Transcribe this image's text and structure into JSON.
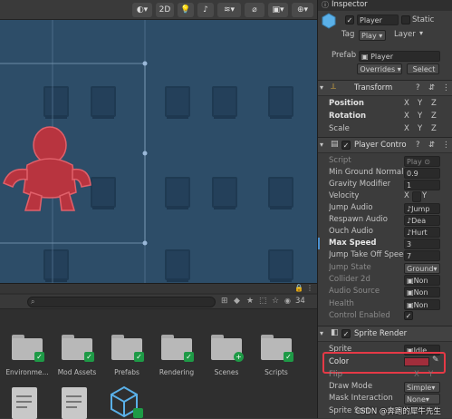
{
  "scene": {
    "toolbar": {
      "mode_2d": "2D"
    }
  },
  "inspector": {
    "tab_title": "Inspector",
    "object": {
      "name": "Player",
      "static_label": "Static",
      "tag_label": "Tag",
      "tag_value": "Play",
      "layer_label": "Layer",
      "prefab_label": "Prefab",
      "prefab_value": "Player",
      "overrides_label": "Overrides",
      "select_label": "Select"
    },
    "transform": {
      "title": "Transform",
      "position_label": "Position",
      "rotation_label": "Rotation",
      "scale_label": "Scale",
      "x": "X",
      "y": "Y",
      "z": "Z"
    },
    "player_controller": {
      "title": "Player Contro",
      "script_label": "Script",
      "script_value": "Play",
      "min_ground_label": "Min Ground Normal Y",
      "min_ground_value": "0.9",
      "gravity_label": "Gravity Modifier",
      "gravity_value": "1",
      "velocity_label": "Velocity",
      "velocity_x": "X",
      "velocity_y": "Y",
      "jump_audio_label": "Jump Audio",
      "jump_audio_value": "Jump",
      "respawn_audio_label": "Respawn Audio",
      "respawn_audio_value": "Dea",
      "ouch_audio_label": "Ouch Audio",
      "ouch_audio_value": "Hurt",
      "max_speed_label": "Max Speed",
      "max_speed_value": "3",
      "jump_take_off_label": "Jump Take Off Speed",
      "jump_take_off_value": "7",
      "jump_state_label": "Jump State",
      "jump_state_value": "Ground",
      "collider_label": "Collider 2d",
      "collider_value": "Non",
      "audio_source_label": "Audio Source",
      "audio_source_value": "Non",
      "health_label": "Health",
      "health_value": "Non",
      "control_enabled_label": "Control Enabled"
    },
    "sprite_renderer": {
      "title": "Sprite Render",
      "sprite_label": "Sprite",
      "sprite_value": "Idle",
      "color_label": "Color",
      "color_value": "#a12d3b",
      "flip_label": "Flip",
      "flip_x": "X",
      "flip_y": "Y",
      "draw_mode_label": "Draw Mode",
      "draw_mode_value": "Simple",
      "mask_interaction_label": "Mask Interaction",
      "mask_interaction_value": "None",
      "sprite_sort_label": "Sprite Sort"
    }
  },
  "project": {
    "hidden_count": "34",
    "folders": [
      {
        "label": "Environme..."
      },
      {
        "label": "Mod Assets"
      },
      {
        "label": "Prefabs"
      },
      {
        "label": "Rendering"
      },
      {
        "label": "Scenes"
      },
      {
        "label": "Scripts"
      }
    ]
  },
  "watermark": "CSDN @奔跑的犀牛先生",
  "colors": {
    "highlight": "#e63946",
    "player": "#b8343f",
    "scene_bg": "#2d4d68"
  }
}
